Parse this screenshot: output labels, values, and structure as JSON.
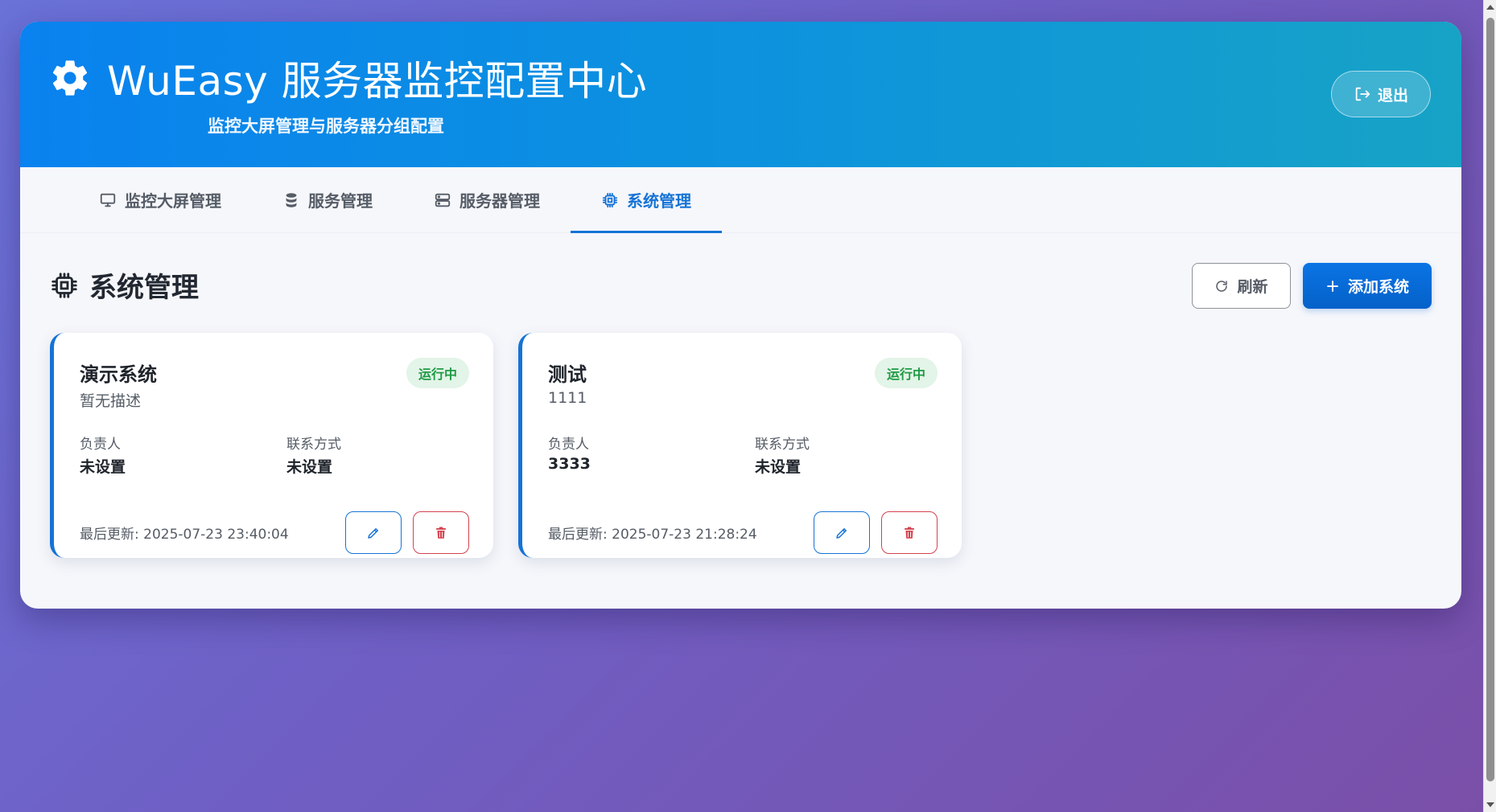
{
  "header": {
    "title": "WuEasy 服务器监控配置中心",
    "subtitle": "监控大屏管理与服务器分组配置",
    "logout_label": "退出"
  },
  "tabs": [
    {
      "label": "监控大屏管理",
      "icon": "monitor-icon",
      "active": false
    },
    {
      "label": "服务管理",
      "icon": "database-icon",
      "active": false
    },
    {
      "label": "服务器管理",
      "icon": "server-icon",
      "active": false
    },
    {
      "label": "系统管理",
      "icon": "cpu-icon",
      "active": true
    }
  ],
  "section": {
    "title": "系统管理",
    "refresh_label": "刷新",
    "add_label": "添加系统"
  },
  "systems": [
    {
      "name": "演示系统",
      "description": "暂无描述",
      "status": "运行中",
      "owner_label": "负责人",
      "owner": "未设置",
      "contact_label": "联系方式",
      "contact": "未设置",
      "updated": "最后更新: 2025-07-23 23:40:04"
    },
    {
      "name": "测试",
      "description": "1111",
      "status": "运行中",
      "owner_label": "负责人",
      "owner": "3333",
      "contact_label": "联系方式",
      "contact": "未设置",
      "updated": "最后更新: 2025-07-23 21:28:24"
    }
  ],
  "colors": {
    "accent": "#1573d6",
    "status_running_bg": "#e3f4e8",
    "status_running_text": "#1f9b45",
    "danger": "#d4424f"
  }
}
